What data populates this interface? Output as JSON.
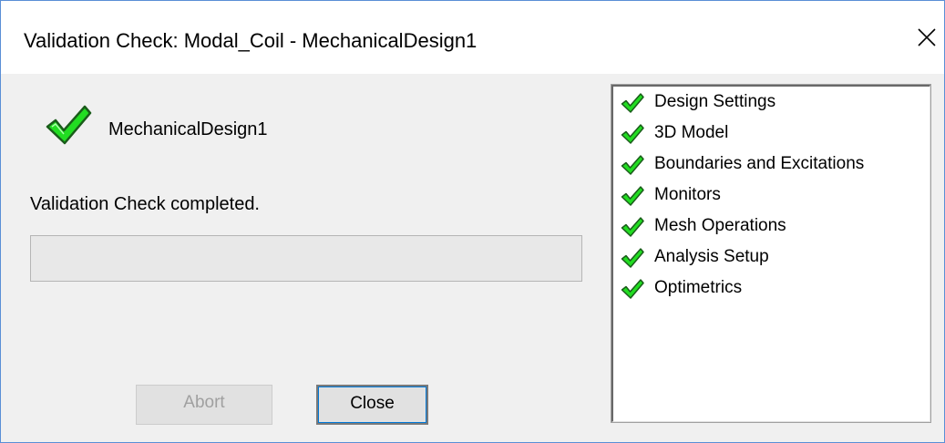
{
  "window": {
    "title": "Validation Check: Modal_Coil - MechanicalDesign1",
    "close_glyph": "✕"
  },
  "design": {
    "name": "MechanicalDesign1",
    "icon": "green-check-icon"
  },
  "status": {
    "message": "Validation Check completed.",
    "progress_fraction": 0
  },
  "buttons": {
    "abort_label": "Abort",
    "abort_enabled": false,
    "close_label": "Close"
  },
  "checks": {
    "items": [
      {
        "label": "Design Settings",
        "icon": "green-check-icon"
      },
      {
        "label": "3D Model",
        "icon": "green-check-icon"
      },
      {
        "label": "Boundaries and Excitations",
        "icon": "green-check-icon"
      },
      {
        "label": "Monitors",
        "icon": "green-check-icon"
      },
      {
        "label": "Mesh Operations",
        "icon": "green-check-icon"
      },
      {
        "label": "Analysis Setup",
        "icon": "green-check-icon"
      },
      {
        "label": "Optimetrics",
        "icon": "green-check-icon"
      }
    ]
  },
  "colors": {
    "check_fill": "#22dd22",
    "check_outline": "#1a5c1a",
    "window_border": "#5a8fd6"
  }
}
